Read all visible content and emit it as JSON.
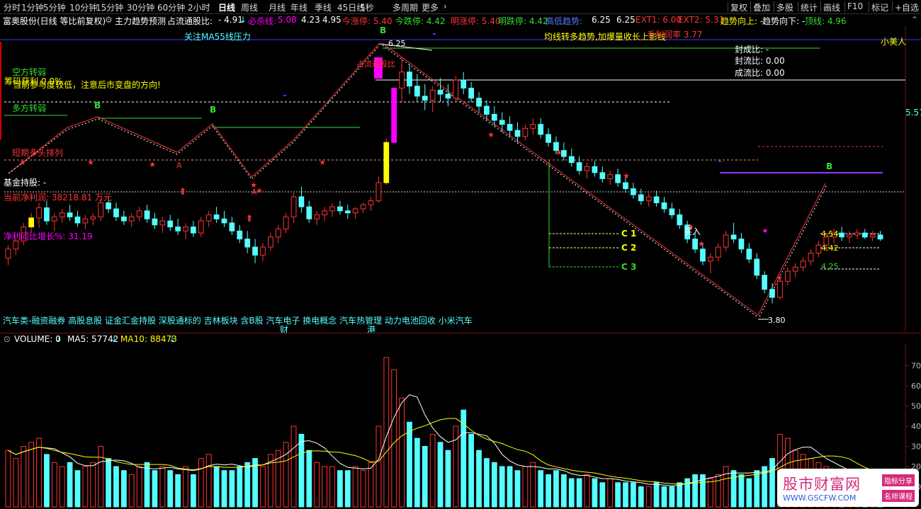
{
  "toolbar": {
    "left": [
      "分时",
      "1分钟",
      "5分钟",
      "10分钟",
      "15分钟",
      "30分钟",
      "60分钟",
      "2小时",
      "日线",
      "周线",
      "月线",
      "年线",
      "季线",
      "45日线",
      "5秒",
      "多周期",
      "更多"
    ],
    "active": "日线",
    "right": [
      "复权",
      "叠加",
      "多股",
      "统计",
      "画线",
      "F10",
      "标记",
      "+自选"
    ]
  },
  "infobar": {
    "title": "富奥股份(日线 等比前复权)",
    "indicator": "主力趋势预测",
    "float_label": "占流通股比:",
    "float_val": "- 4.91",
    "bisha_label": "必杀线:",
    "bisha_val": "5.08",
    "v1": "4.23",
    "v2": "4.95",
    "jinzhangting": "今涨停: 5.40",
    "jindieting": "今跌停: 4.42",
    "mingzhangting": "明涨停: 5.40",
    "mingdieting": "明跌停: 4.42",
    "gaodi_label": "高低趋势:",
    "v3": "6.25",
    "v4": "6.25",
    "ext1": "EXT1: 6.00",
    "ext2": "EXT2: 5.31",
    "qushi_up": "趋势向上: -",
    "qushi_down": "趋势向下: -",
    "dingxian": "顶线: 4.96"
  },
  "overlay": {
    "ma55": "关注MA55线压力",
    "kongfang": "空方转弱",
    "yingli": "筹码获利 0.0%",
    "warning": "当前参与度较低，注意后市变盘的方向!",
    "duofang": "多方转弱",
    "duotou": "短期多头排列",
    "jijin": "基金持股: -",
    "jinglirun": "当前净利润:  38218.81  万元",
    "zengzhang": "净利同比增长%:  31.19",
    "junxian": "均线转多趋势,加爆量收长上影线",
    "maolilv": "毛利润率 3.77",
    "fengcheng": "封成比: -",
    "fengliu": "封流比: 0.00",
    "chengliu": "成流比: 0.00",
    "xiaomeiren": "小美人",
    "price_label": "5.57",
    "zhanliu": "占流通股比",
    "concepts": "汽车类-融资融券 高股息股 证金汇金持股 深股通标的 吉林板块 含B股 汽车电子 换电概念 汽车热管理 动力电池回收 小米汽车",
    "cai": "财",
    "gang": "港",
    "high_price": "6.25",
    "low_price": "3.80",
    "mairu": "买入",
    "c1": "C 1",
    "c2": "C 2",
    "c3": "C 3",
    "lvl1": "4.54",
    "lvl2": "4.42",
    "lvl3": "4.25",
    "b_mark": "B",
    "a_mark": "A"
  },
  "volume": {
    "label": "VOLUME: 0",
    "ma5": "MA5: 57742",
    "ma10": "MA10: 88473",
    "yticks": [
      "70",
      "60",
      "50",
      "40",
      "30",
      "20",
      "10"
    ]
  },
  "watermark": {
    "site": "股市财富网",
    "url": "WWW.GSCFW.COM",
    "tag1": "指标分享",
    "tag2": "名师课程"
  },
  "colors": {
    "up": "#ff3333",
    "down": "#54ffff",
    "yellow": "#ffff00",
    "green": "#33dd33",
    "magenta": "#ff00ff",
    "white": "#ffffff"
  },
  "chart_data": {
    "type": "candlestick",
    "ohlc": [
      [
        4.25,
        4.38,
        4.18,
        4.34
      ],
      [
        4.34,
        4.45,
        4.28,
        4.42
      ],
      [
        4.42,
        4.6,
        4.38,
        4.56
      ],
      [
        4.56,
        4.7,
        4.5,
        4.65
      ],
      [
        4.65,
        4.8,
        4.55,
        4.75
      ],
      [
        4.75,
        4.82,
        4.58,
        4.62
      ],
      [
        4.62,
        4.7,
        4.52,
        4.66
      ],
      [
        4.66,
        4.74,
        4.6,
        4.7
      ],
      [
        4.7,
        4.78,
        4.62,
        4.66
      ],
      [
        4.66,
        4.72,
        4.56,
        4.6
      ],
      [
        4.6,
        4.68,
        4.54,
        4.64
      ],
      [
        4.64,
        4.7,
        4.58,
        4.66
      ],
      [
        4.66,
        4.84,
        4.62,
        4.8
      ],
      [
        4.8,
        4.86,
        4.7,
        4.74
      ],
      [
        4.74,
        4.8,
        4.62,
        4.66
      ],
      [
        4.66,
        4.72,
        4.58,
        4.62
      ],
      [
        4.62,
        4.7,
        4.56,
        4.66
      ],
      [
        4.66,
        4.76,
        4.62,
        4.72
      ],
      [
        4.72,
        4.78,
        4.6,
        4.64
      ],
      [
        4.64,
        4.7,
        4.54,
        4.58
      ],
      [
        4.58,
        4.66,
        4.5,
        4.62
      ],
      [
        4.62,
        4.68,
        4.52,
        4.56
      ],
      [
        4.56,
        4.64,
        4.48,
        4.52
      ],
      [
        4.52,
        4.6,
        4.44,
        4.56
      ],
      [
        4.56,
        4.62,
        4.46,
        4.5
      ],
      [
        4.5,
        4.66,
        4.46,
        4.62
      ],
      [
        4.62,
        4.72,
        4.56,
        4.68
      ],
      [
        4.68,
        4.76,
        4.6,
        4.64
      ],
      [
        4.64,
        4.72,
        4.56,
        4.6
      ],
      [
        4.6,
        4.66,
        4.48,
        4.52
      ],
      [
        4.52,
        4.58,
        4.4,
        4.44
      ],
      [
        4.44,
        4.52,
        4.3,
        4.36
      ],
      [
        4.36,
        4.44,
        4.2,
        4.28
      ],
      [
        4.28,
        4.4,
        4.22,
        4.36
      ],
      [
        4.36,
        4.5,
        4.32,
        4.46
      ],
      [
        4.46,
        4.58,
        4.4,
        4.54
      ],
      [
        4.54,
        4.7,
        4.5,
        4.66
      ],
      [
        4.66,
        4.9,
        4.6,
        4.86
      ],
      [
        4.86,
        4.96,
        4.7,
        4.76
      ],
      [
        4.76,
        4.82,
        4.6,
        4.64
      ],
      [
        4.64,
        4.72,
        4.58,
        4.68
      ],
      [
        4.68,
        4.76,
        4.62,
        4.72
      ],
      [
        4.72,
        4.8,
        4.66,
        4.76
      ],
      [
        4.76,
        4.82,
        4.68,
        4.72
      ],
      [
        4.72,
        4.78,
        4.64,
        4.7
      ],
      [
        4.7,
        4.76,
        4.64,
        4.74
      ],
      [
        4.74,
        4.8,
        4.7,
        4.78
      ],
      [
        4.78,
        4.86,
        4.72,
        4.82
      ],
      [
        4.82,
        5.06,
        4.8,
        5.0
      ],
      [
        5.0,
        5.44,
        4.98,
        5.4
      ],
      [
        5.4,
        5.94,
        5.4,
        5.94
      ],
      [
        5.94,
        6.25,
        5.8,
        6.1
      ],
      [
        6.1,
        6.18,
        5.88,
        5.96
      ],
      [
        5.96,
        6.08,
        5.8,
        5.86
      ],
      [
        5.86,
        5.98,
        5.72,
        5.82
      ],
      [
        5.82,
        5.96,
        5.7,
        5.92
      ],
      [
        5.92,
        6.04,
        5.8,
        5.88
      ],
      [
        5.88,
        5.98,
        5.76,
        5.84
      ],
      [
        5.84,
        6.06,
        5.8,
        6.02
      ],
      [
        6.02,
        6.1,
        5.88,
        5.94
      ],
      [
        5.94,
        6.0,
        5.8,
        5.84
      ],
      [
        5.84,
        5.9,
        5.7,
        5.76
      ],
      [
        5.76,
        5.82,
        5.62,
        5.68
      ],
      [
        5.68,
        5.76,
        5.56,
        5.62
      ],
      [
        5.62,
        5.7,
        5.5,
        5.58
      ],
      [
        5.58,
        5.66,
        5.46,
        5.52
      ],
      [
        5.52,
        5.6,
        5.4,
        5.46
      ],
      [
        5.46,
        5.58,
        5.42,
        5.54
      ],
      [
        5.54,
        5.64,
        5.48,
        5.58
      ],
      [
        5.58,
        5.64,
        5.44,
        5.48
      ],
      [
        5.48,
        5.54,
        5.36,
        5.4
      ],
      [
        5.4,
        5.46,
        5.28,
        5.32
      ],
      [
        5.32,
        5.4,
        5.22,
        5.26
      ],
      [
        5.26,
        5.34,
        5.16,
        5.2
      ],
      [
        5.2,
        5.26,
        5.08,
        5.12
      ],
      [
        5.12,
        5.2,
        5.04,
        5.16
      ],
      [
        5.16,
        5.22,
        5.06,
        5.1
      ],
      [
        5.1,
        5.16,
        5.0,
        5.04
      ],
      [
        5.04,
        5.12,
        4.98,
        5.08
      ],
      [
        5.08,
        5.14,
        4.96,
        5.0
      ],
      [
        5.0,
        5.06,
        4.9,
        4.94
      ],
      [
        4.94,
        5.0,
        4.84,
        4.88
      ],
      [
        4.88,
        4.94,
        4.78,
        4.82
      ],
      [
        4.82,
        4.9,
        4.76,
        4.86
      ],
      [
        4.86,
        4.92,
        4.76,
        4.8
      ],
      [
        4.8,
        4.86,
        4.7,
        4.74
      ],
      [
        4.74,
        4.8,
        4.64,
        4.68
      ],
      [
        4.68,
        4.74,
        4.54,
        4.58
      ],
      [
        4.58,
        4.62,
        4.4,
        4.44
      ],
      [
        4.44,
        4.5,
        4.3,
        4.34
      ],
      [
        4.34,
        4.4,
        4.18,
        4.22
      ],
      [
        4.22,
        4.3,
        4.1,
        4.26
      ],
      [
        4.26,
        4.4,
        4.22,
        4.36
      ],
      [
        4.36,
        4.52,
        4.32,
        4.48
      ],
      [
        4.48,
        4.6,
        4.4,
        4.44
      ],
      [
        4.44,
        4.5,
        4.3,
        4.34
      ],
      [
        4.34,
        4.4,
        4.2,
        4.24
      ],
      [
        4.24,
        4.3,
        4.04,
        4.08
      ],
      [
        4.08,
        4.12,
        3.9,
        3.94
      ],
      [
        3.94,
        4.0,
        3.8,
        3.86
      ],
      [
        3.86,
        4.06,
        3.84,
        4.02
      ],
      [
        4.02,
        4.16,
        3.98,
        4.12
      ],
      [
        4.12,
        4.2,
        4.06,
        4.16
      ],
      [
        4.16,
        4.26,
        4.12,
        4.22
      ],
      [
        4.22,
        4.34,
        4.18,
        4.3
      ],
      [
        4.3,
        4.42,
        4.26,
        4.38
      ],
      [
        4.38,
        4.5,
        4.32,
        4.46
      ],
      [
        4.46,
        4.54,
        4.4,
        4.5
      ],
      [
        4.5,
        4.56,
        4.42,
        4.46
      ],
      [
        4.46,
        4.52,
        4.4,
        4.48
      ],
      [
        4.48,
        4.54,
        4.44,
        4.5
      ],
      [
        4.5,
        4.54,
        4.44,
        4.46
      ],
      [
        4.46,
        4.52,
        4.42,
        4.48
      ],
      [
        4.48,
        4.52,
        4.42,
        4.44
      ]
    ],
    "volume": [
      28,
      24,
      30,
      32,
      34,
      26,
      22,
      20,
      22,
      18,
      20,
      22,
      30,
      24,
      20,
      18,
      16,
      20,
      22,
      18,
      20,
      18,
      16,
      20,
      16,
      24,
      26,
      20,
      18,
      18,
      20,
      22,
      24,
      20,
      26,
      28,
      32,
      40,
      36,
      28,
      22,
      20,
      20,
      18,
      18,
      20,
      18,
      22,
      40,
      74,
      68,
      54,
      42,
      34,
      30,
      36,
      32,
      28,
      40,
      48,
      36,
      28,
      24,
      22,
      20,
      20,
      18,
      20,
      22,
      18,
      16,
      18,
      16,
      14,
      14,
      16,
      14,
      12,
      14,
      12,
      12,
      12,
      10,
      10,
      12,
      10,
      10,
      12,
      14,
      16,
      16,
      14,
      16,
      20,
      18,
      16,
      14,
      18,
      20,
      24,
      36,
      34,
      28,
      26,
      24,
      22,
      20,
      18,
      16,
      14,
      14,
      14,
      12,
      12
    ],
    "ylim": [
      3.6,
      6.45
    ]
  }
}
